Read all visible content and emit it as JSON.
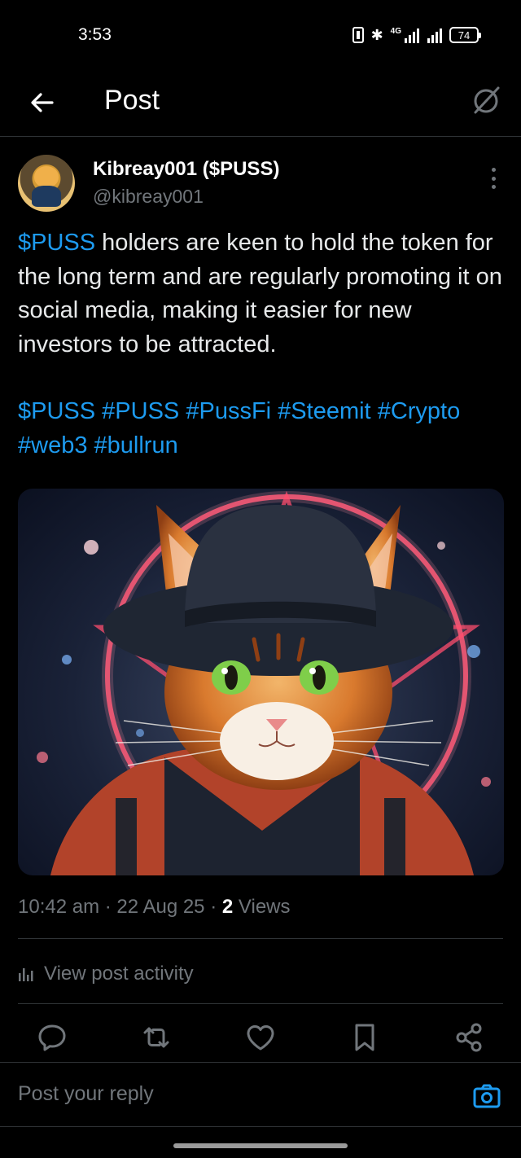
{
  "status_bar": {
    "time": "3:53",
    "network": "4G",
    "battery": "74",
    "icons": [
      "vibrate-icon",
      "bluetooth-icon",
      "signal-icon",
      "battery-icon"
    ]
  },
  "header": {
    "title": "Post",
    "icons": [
      "back-arrow-icon",
      "grok-icon"
    ]
  },
  "post": {
    "author": {
      "display_name": "Kibreay001 ($PUSS)",
      "handle": "@kibreay001"
    },
    "body": {
      "cashtag": "$PUSS",
      "text": " holders are keen to hold the token for the long term and are regularly promoting it on social media, making it easier for new investors to be attracted."
    },
    "tags": [
      "$PUSS",
      "#PUSS",
      "#PussFi",
      "#Steemit",
      "#Crypto",
      "#web3",
      "#bullrun"
    ],
    "meta": {
      "time": "10:42 am",
      "date": "22 Aug 25",
      "views_count": "2",
      "views_label": "Views",
      "separator": "·"
    },
    "activity_label": "View post activity"
  },
  "actions": [
    "reply-icon",
    "repost-icon",
    "like-icon",
    "bookmark-icon",
    "share-icon"
  ],
  "reply": {
    "placeholder": "Post your reply"
  },
  "colors": {
    "background": "#000000",
    "text": "#e7e9ea",
    "muted": "#71767b",
    "accent": "#1d9bf0",
    "divider": "#2f3336"
  }
}
